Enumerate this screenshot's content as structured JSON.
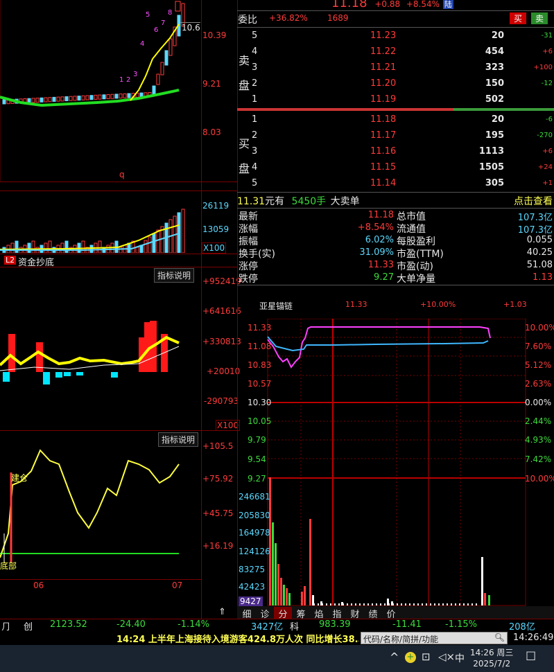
{
  "header": {
    "price": "11.18",
    "change": "+0.88",
    "change_pct": "+8.54%",
    "market_tag": "陆"
  },
  "weibi": {
    "label": "委比",
    "value": "+36.82%",
    "diff": "1689",
    "buy_btn": "买",
    "sell_btn": "卖"
  },
  "sell_side_label": [
    "卖",
    "盘"
  ],
  "buy_side_label": [
    "买",
    "盘"
  ],
  "asks": [
    {
      "level": "5",
      "price": "11.23",
      "vol": "20",
      "chg": "-31"
    },
    {
      "level": "4",
      "price": "11.22",
      "vol": "454",
      "chg": "+6"
    },
    {
      "level": "3",
      "price": "11.21",
      "vol": "323",
      "chg": "+100"
    },
    {
      "level": "2",
      "price": "11.20",
      "vol": "150",
      "chg": "-12"
    },
    {
      "level": "1",
      "price": "11.19",
      "vol": "502",
      "chg": ""
    }
  ],
  "bids": [
    {
      "level": "1",
      "price": "11.18",
      "vol": "20",
      "chg": "-6"
    },
    {
      "level": "2",
      "price": "11.17",
      "vol": "195",
      "chg": "-270"
    },
    {
      "level": "3",
      "price": "11.16",
      "vol": "1113",
      "chg": "+6"
    },
    {
      "level": "4",
      "price": "11.15",
      "vol": "1505",
      "chg": "+24"
    },
    {
      "level": "5",
      "price": "11.14",
      "vol": "305",
      "chg": "+1"
    }
  ],
  "big_order": {
    "price": "11.31",
    "yuan_you": "元有",
    "qty": "5450手",
    "type": "大卖单",
    "link": "点击查看"
  },
  "quote": {
    "left": [
      {
        "label": "最新",
        "value": "11.18"
      },
      {
        "label": "涨幅",
        "value": "+8.54%"
      },
      {
        "label": "振幅",
        "value": "6.02%"
      },
      {
        "label": "换手(实)",
        "value": "31.09%"
      },
      {
        "label": "涨停",
        "value": "11.33"
      },
      {
        "label": "跌停",
        "value": "9.27"
      }
    ],
    "right": [
      {
        "label": "总市值",
        "value": "107.3亿"
      },
      {
        "label": "流通值",
        "value": "107.3亿"
      },
      {
        "label": "每股盈利",
        "value": "0.055"
      },
      {
        "label": "市盈(TTM)",
        "value": "40.25"
      },
      {
        "label": "市盈(动)",
        "value": "51.08"
      },
      {
        "label": "大单净量",
        "value": "1.13"
      }
    ]
  },
  "intraday": {
    "name": "亚星锚链",
    "limit_price": "11.33",
    "limit_pct": "+10.00%",
    "extra": "+1.03",
    "left_axis": [
      "11.33",
      "11.08",
      "10.83",
      "10.57",
      "10.30",
      "10.05",
      "9.79",
      "9.54",
      "9.27"
    ],
    "right_axis": [
      "10.00%",
      "7.60%",
      "5.12%",
      "2.63%",
      "0.00%",
      "2.44%",
      "4.93%",
      "7.42%",
      "10.00%"
    ],
    "vol_axis": [
      "246681",
      "205830",
      "164978",
      "124126",
      "83275",
      "42423",
      "9427"
    ],
    "tabs": [
      "细",
      "诊",
      "分",
      "筹",
      "焰",
      "指",
      "财",
      "绩",
      "价"
    ]
  },
  "kline": {
    "price_axis": [
      "10.39",
      "9.21",
      "8.03"
    ],
    "current_price_tag": "10.6",
    "marker_q": "q",
    "numbers": [
      "1",
      "2",
      "3",
      "4",
      "5",
      "6",
      "7",
      "8"
    ],
    "vol_axis": [
      "26119",
      "13059",
      "X100"
    ],
    "indicator_tag": "L2",
    "indicator_name": "资金抄底",
    "ind1_btn": "指标说明",
    "ind1_axis": [
      "+952419",
      "+641616",
      "+330813",
      "+20010",
      "-290793",
      "X100"
    ],
    "ind2_btn": "指标说明",
    "ind2_axis": [
      "+105.5",
      "+75.92",
      "+45.75",
      "+16.19"
    ],
    "ind2_labels": [
      "建仓",
      "底部"
    ],
    "date_labels": [
      "06",
      "07"
    ]
  },
  "index_bar": {
    "item1_label": "创",
    "item1_value": "2123.52",
    "item1_change": "-24.40",
    "item1_pct": "-1.14%",
    "item1_amount": "3427亿",
    "item2_label": "科",
    "item2_value": "983.39",
    "item2_change": "-11.41",
    "item2_pct": "-1.15%",
    "item2_amount": "208亿"
  },
  "news": {
    "text": "14:24 上半年上海接待入境游客424.8万人次 同比增长38.5%",
    "search_placeholder": "代码/名称/简拼/功能",
    "clock": "14:26:49"
  },
  "taskbar": {
    "ime": "中",
    "time": "14:26 周三",
    "date": "2025/7/2"
  }
}
